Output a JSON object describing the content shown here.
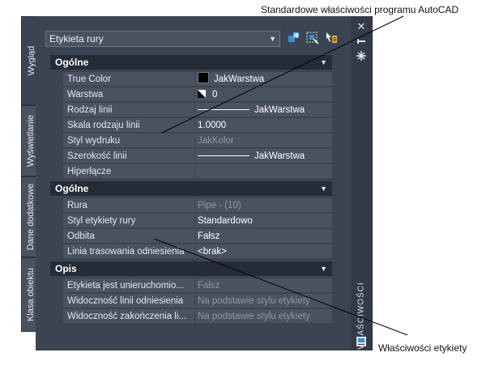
{
  "callouts": {
    "top": "Standardowe właściwości programu AutoCAD",
    "bottom": "Właściwości etykiety"
  },
  "side_tabs": [
    "Wygląd",
    "Wyświetlanie",
    "Dane dodatkowe",
    "Klasa obiektu"
  ],
  "palette_title": "WŁAŚCIWOŚCI",
  "selector": {
    "value": "Etykieta rury"
  },
  "sections": [
    {
      "title": "Ogólne",
      "rows": [
        {
          "name": "True Color",
          "value": "JakWarstwa"
        },
        {
          "name": "Warstwa",
          "value": "0"
        },
        {
          "name": "Rodzaj linii",
          "value": "JakWarstwa"
        },
        {
          "name": "Skala rodzaju linii",
          "value": "1.0000"
        },
        {
          "name": "Styl wydruku",
          "value": "JakKolor"
        },
        {
          "name": "Szerokość linii",
          "value": "JakWarstwa"
        },
        {
          "name": "Hiperłącze",
          "value": ""
        }
      ]
    },
    {
      "title": "Ogólne",
      "rows": [
        {
          "name": "Rura",
          "value": "Pipe - (10)"
        },
        {
          "name": "Styl etykiety rury",
          "value": "Standardowo"
        },
        {
          "name": "Odbita",
          "value": "Fałsz"
        },
        {
          "name": "Linia trasowania odniesienia",
          "value": "<brak>"
        }
      ]
    },
    {
      "title": "Opis",
      "rows": [
        {
          "name": "Etykieta jest unieruchomio...",
          "value": "Fałsz"
        },
        {
          "name": "Widoczność linii odniesienia",
          "value": "Na podstawie stylu etykiety"
        },
        {
          "name": "Widoczność zakończenia li...",
          "value": "Na podstawie stylu etykiety"
        }
      ]
    }
  ],
  "icons": {
    "close": "close-icon",
    "pin": "pin-icon",
    "settings": "options-icon",
    "quick_select": "quick-select-icon",
    "select_objects": "select-objects-icon",
    "toggle_pickadd": "pickadd-icon",
    "palette_menu": "palette-menu-icon"
  },
  "colors": {
    "panel": "#3b4453",
    "row": "#4a5262",
    "section": "#262c36",
    "accent_blue": "#3a8fd6"
  }
}
